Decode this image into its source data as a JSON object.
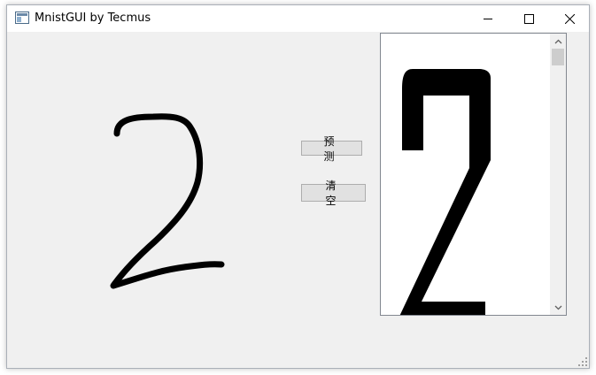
{
  "window": {
    "title": "MnistGUI by Tecmus"
  },
  "titlebar_icons": {
    "app": "app-icon",
    "minimize": "minimize-icon",
    "maximize": "maximize-icon",
    "close": "close-icon"
  },
  "buttons": {
    "predict_label": "预 测",
    "clear_label": "清 空"
  },
  "result": {
    "digit": "2"
  },
  "colors": {
    "window_bg": "#f0f0f0",
    "titlebar_bg": "#ffffff",
    "stroke": "#000000",
    "button_bg": "#e1e1e1",
    "button_border": "#adadad"
  }
}
